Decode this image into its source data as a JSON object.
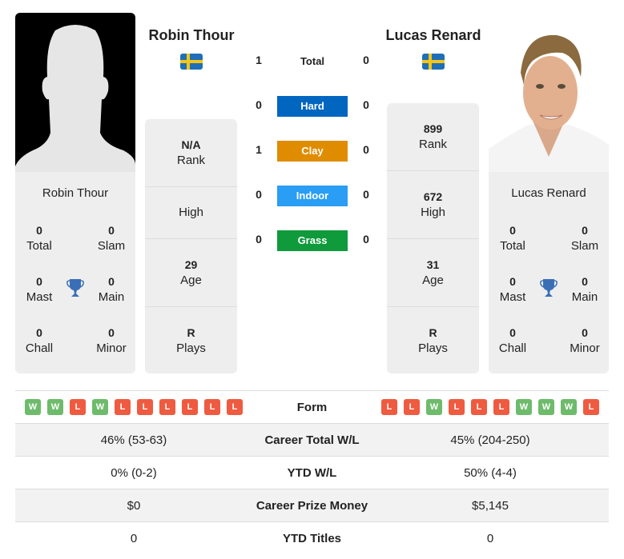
{
  "players": {
    "left": {
      "name": "Robin Thour",
      "country_flag": "sweden-flag",
      "photo": "silhouette-placeholder",
      "stats": [
        {
          "value": "N/A",
          "label": "Rank"
        },
        {
          "value": "",
          "label": "High"
        },
        {
          "value": "29",
          "label": "Age"
        },
        {
          "value": "R",
          "label": "Plays"
        }
      ],
      "titles": {
        "total": {
          "value": "0",
          "label": "Total"
        },
        "slam": {
          "value": "0",
          "label": "Slam"
        },
        "mast": {
          "value": "0",
          "label": "Mast"
        },
        "main": {
          "value": "0",
          "label": "Main"
        },
        "chall": {
          "value": "0",
          "label": "Chall"
        },
        "minor": {
          "value": "0",
          "label": "Minor"
        }
      }
    },
    "right": {
      "name": "Lucas Renard",
      "country_flag": "sweden-flag",
      "photo": "player-headshot",
      "stats": [
        {
          "value": "899",
          "label": "Rank"
        },
        {
          "value": "672",
          "label": "High"
        },
        {
          "value": "31",
          "label": "Age"
        },
        {
          "value": "R",
          "label": "Plays"
        }
      ],
      "titles": {
        "total": {
          "value": "0",
          "label": "Total"
        },
        "slam": {
          "value": "0",
          "label": "Slam"
        },
        "mast": {
          "value": "0",
          "label": "Mast"
        },
        "main": {
          "value": "0",
          "label": "Main"
        },
        "chall": {
          "value": "0",
          "label": "Chall"
        },
        "minor": {
          "value": "0",
          "label": "Minor"
        }
      }
    }
  },
  "h2h": [
    {
      "label": "Total",
      "left": "1",
      "right": "0",
      "color": ""
    },
    {
      "label": "Hard",
      "left": "0",
      "right": "0",
      "color": "#0066c0"
    },
    {
      "label": "Clay",
      "left": "1",
      "right": "0",
      "color": "#e08c00"
    },
    {
      "label": "Indoor",
      "left": "0",
      "right": "0",
      "color": "#2a9df4"
    },
    {
      "label": "Grass",
      "left": "0",
      "right": "0",
      "color": "#0f9a3c"
    }
  ],
  "comparison": {
    "form_label": "Form",
    "form_left": [
      "W",
      "W",
      "L",
      "W",
      "L",
      "L",
      "L",
      "L",
      "L",
      "L"
    ],
    "form_right": [
      "L",
      "L",
      "W",
      "L",
      "L",
      "L",
      "W",
      "W",
      "W",
      "L"
    ],
    "rows": [
      {
        "label": "Career Total W/L",
        "left": "46% (53-63)",
        "right": "45% (204-250)"
      },
      {
        "label": "YTD W/L",
        "left": "0% (0-2)",
        "right": "50% (4-4)"
      },
      {
        "label": "Career Prize Money",
        "left": "$0",
        "right": "$5,145"
      },
      {
        "label": "YTD Titles",
        "left": "0",
        "right": "0"
      }
    ]
  }
}
